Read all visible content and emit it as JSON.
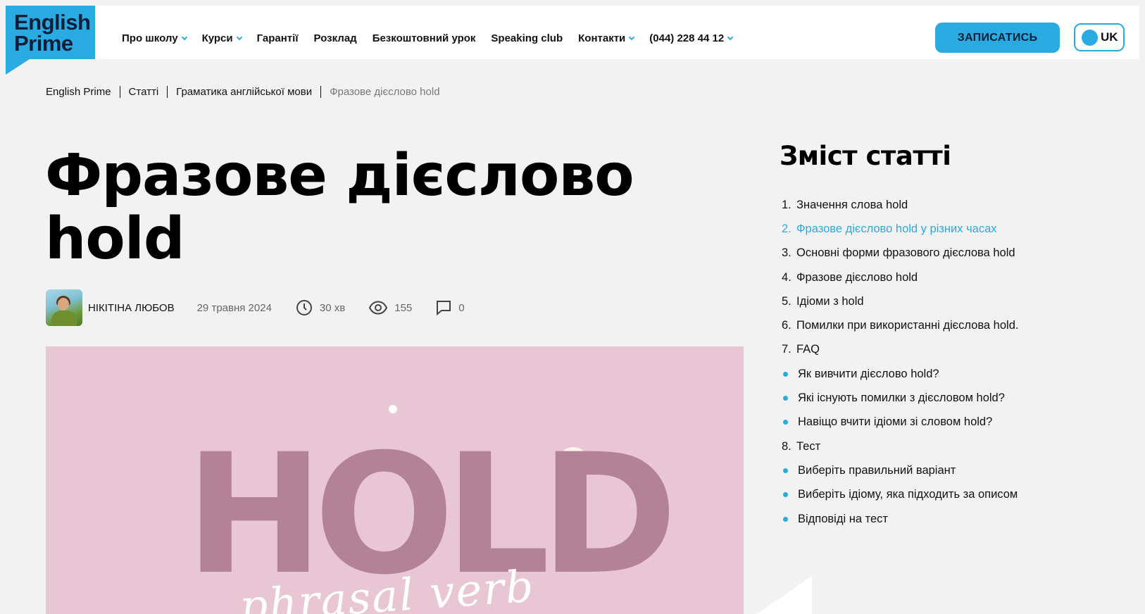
{
  "brand": {
    "line1": "English",
    "line2": "Prime",
    "color": "#29abe2"
  },
  "nav": [
    {
      "label": "Про школу",
      "dropdown": true
    },
    {
      "label": "Курси",
      "dropdown": true
    },
    {
      "label": "Гарантії",
      "dropdown": false
    },
    {
      "label": "Розклад",
      "dropdown": false
    },
    {
      "label": "Безкоштовний урок",
      "dropdown": false
    },
    {
      "label": "Speaking club",
      "dropdown": false
    },
    {
      "label": "Контакти",
      "dropdown": true
    },
    {
      "label": "(044) 228 44 12",
      "dropdown": true
    }
  ],
  "header": {
    "cta_label": "ЗАПИСАТИСЬ",
    "lang_label": "UK"
  },
  "breadcrumb": [
    "English Prime",
    "Статті",
    "Граматика англійської мови",
    "Фразове дієслово hold"
  ],
  "article": {
    "title_line1": "Фразове дієслово",
    "title_line2": "hold",
    "author": "НІКІТІНА ЛЮБОВ",
    "date": "29 травня 2024",
    "read_time": "30 хв",
    "views": "155",
    "comments": "0"
  },
  "hero": {
    "word": "HOLD",
    "script": "phrasal verb",
    "bg_color": "#e8c6d4",
    "word_color": "#b48296"
  },
  "toc": {
    "title": "Зміст статті",
    "items": [
      {
        "type": "num",
        "marker": "1.",
        "label": "Значення слова hold",
        "active": false
      },
      {
        "type": "num",
        "marker": "2.",
        "label": "Фразове дієслово hold у різних часах",
        "active": true
      },
      {
        "type": "num",
        "marker": "3.",
        "label": "Основні форми фразового дієслова hold",
        "active": false
      },
      {
        "type": "num",
        "marker": "4.",
        "label": "Фразове дієслово hold",
        "active": false
      },
      {
        "type": "num",
        "marker": "5.",
        "label": "Ідіоми з hold",
        "active": false
      },
      {
        "type": "num",
        "marker": "6.",
        "label": "Помилки при використанні дієслова hold.",
        "active": false
      },
      {
        "type": "num",
        "marker": "7.",
        "label": "FAQ",
        "active": false
      },
      {
        "type": "bullet",
        "marker": "",
        "label": "Як вивчити дієслово hold?",
        "active": false
      },
      {
        "type": "bullet",
        "marker": "",
        "label": "Які існують помилки з дієсловом hold?",
        "active": false
      },
      {
        "type": "bullet",
        "marker": "",
        "label": "Навіщо вчити ідіоми зі словом hold?",
        "active": false
      },
      {
        "type": "num",
        "marker": "8.",
        "label": "Тест",
        "active": false
      },
      {
        "type": "bullet",
        "marker": "",
        "label": "Виберіть правильний варіант",
        "active": false
      },
      {
        "type": "bullet",
        "marker": "",
        "label": "Виберіть ідіому, яка підходить за описом",
        "active": false
      },
      {
        "type": "bullet",
        "marker": "",
        "label": "Відповіді на тест",
        "active": false
      }
    ]
  }
}
